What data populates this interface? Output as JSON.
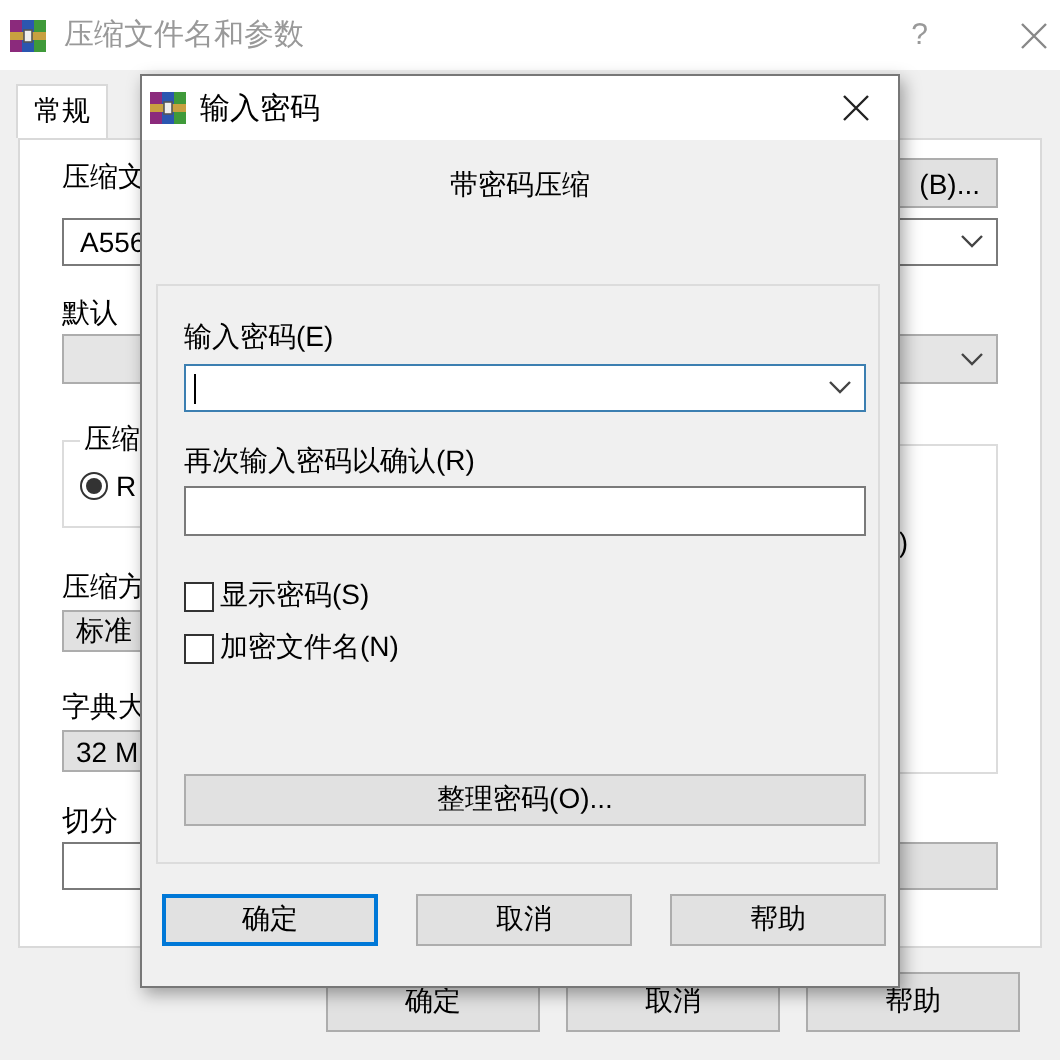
{
  "main_window": {
    "title": "压缩文件名和参数",
    "help": "?",
    "tabs": [
      {
        "label": "常规",
        "selected": true
      }
    ],
    "archive_name_label": "压缩文",
    "browse_button": "(B)...",
    "archive_name_value": "A556",
    "profile_label": "默认",
    "format_group": {
      "title": "压缩",
      "options": [
        {
          "label": "R",
          "selected": true
        }
      ]
    },
    "right_group_fragment": ")",
    "method_label": "压缩方",
    "method_value": "标准",
    "dictionary_label": "字典大",
    "dictionary_value": "32 M",
    "split_label": "切分",
    "buttons": [
      {
        "label": "确定"
      },
      {
        "label": "取消"
      },
      {
        "label": "帮助"
      }
    ]
  },
  "dialog": {
    "title": "输入密码",
    "heading": "带密码压缩",
    "password_label": "输入密码(E)",
    "confirm_label": "再次输入密码以确认(R)",
    "checkboxes": [
      {
        "label": "显示密码(S)",
        "checked": false
      },
      {
        "label": "加密文件名(N)",
        "checked": false
      }
    ],
    "organize_button": "整理密码(O)...",
    "buttons": [
      {
        "label": "确定",
        "default": true
      },
      {
        "label": "取消",
        "default": false
      },
      {
        "label": "帮助",
        "default": false
      }
    ]
  }
}
